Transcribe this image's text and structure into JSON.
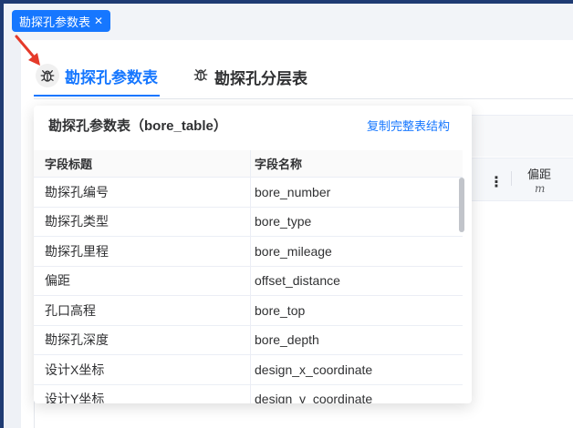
{
  "tag_chip": {
    "label": "勘探孔参数表",
    "close": "✕"
  },
  "tabs": [
    {
      "label": "勘探孔参数表",
      "active": true,
      "icon": "bug-icon"
    },
    {
      "label": "勘探孔分层表",
      "active": false,
      "icon": "bug-icon"
    }
  ],
  "background_table": {
    "column_title": "偏距",
    "column_unit": "m",
    "menu": "⋮"
  },
  "popover": {
    "title": "勘探孔参数表（bore_table）",
    "copy_link": "复制完整表结构",
    "headers": [
      "字段标题",
      "字段名称"
    ],
    "rows": [
      [
        "勘探孔编号",
        "bore_number"
      ],
      [
        "勘探孔类型",
        "bore_type"
      ],
      [
        "勘探孔里程",
        "bore_mileage"
      ],
      [
        "偏距",
        "offset_distance"
      ],
      [
        "孔口高程",
        "bore_top"
      ],
      [
        "勘探孔深度",
        "bore_depth"
      ],
      [
        "设计X坐标",
        "design_x_coordinate"
      ],
      [
        "设计Y坐标",
        "design_y_coordinate"
      ]
    ]
  },
  "colors": {
    "accent": "#1677ff",
    "arrow": "#e53a2a",
    "nav_dark": "#1f3b73"
  }
}
